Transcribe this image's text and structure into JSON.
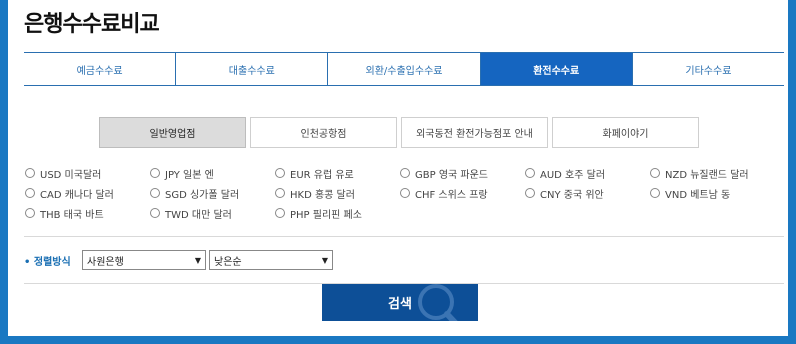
{
  "page": {
    "title": "은행수수료비교"
  },
  "tabs": [
    {
      "label": "예금수수료",
      "active": false
    },
    {
      "label": "대출수수료",
      "active": false
    },
    {
      "label": "외환/수출입수수료",
      "active": false
    },
    {
      "label": "환전수수료",
      "active": true
    },
    {
      "label": "기타수수료",
      "active": false
    }
  ],
  "subtabs": [
    {
      "label": "일반영업점",
      "active": true
    },
    {
      "label": "인천공항점",
      "active": false
    },
    {
      "label": "외국동전 환전가능점포 안내",
      "active": false
    },
    {
      "label": "화페이야기",
      "active": false
    }
  ],
  "currencies": [
    {
      "label": "USD 미국달러"
    },
    {
      "label": "JPY 일본 엔"
    },
    {
      "label": "EUR 유럽 유로"
    },
    {
      "label": "GBP 영국 파운드"
    },
    {
      "label": "AUD 호주 달러"
    },
    {
      "label": "NZD 뉴질랜드 달러"
    },
    {
      "label": "CAD 캐나다 달러"
    },
    {
      "label": "SGD 싱가폴 달러"
    },
    {
      "label": "HKD 홍콩 달러"
    },
    {
      "label": "CHF 스위스 프랑"
    },
    {
      "label": "CNY 중국 위안"
    },
    {
      "label": "VND 베트남 동"
    },
    {
      "label": "THB 태국 바트"
    },
    {
      "label": "TWD 대만 달러"
    },
    {
      "label": "PHP 필리핀 페소"
    }
  ],
  "sort": {
    "label": "정렬방식",
    "bank_select_value": "사원은행",
    "order_select_value": "낮은순"
  },
  "search": {
    "label": "검색"
  },
  "colors": {
    "accent": "#1565c0",
    "frame": "#1a78c2",
    "button": "#0d4f97"
  }
}
